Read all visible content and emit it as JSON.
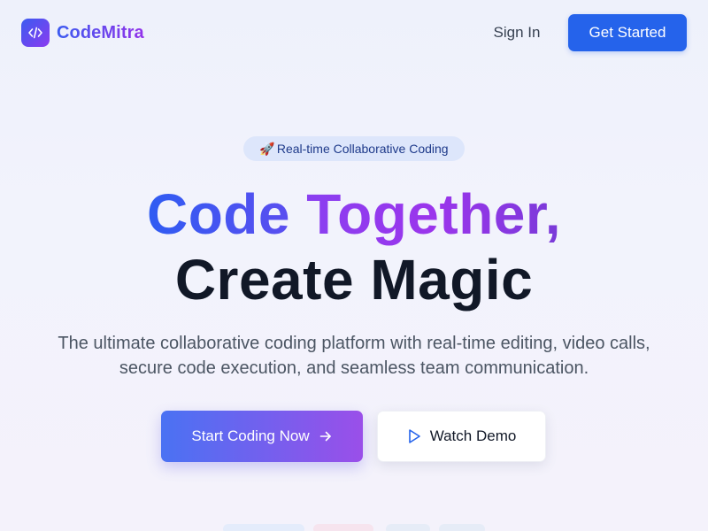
{
  "brand": {
    "name": "CodeMitra",
    "icon": "code-brackets-icon",
    "accent": "#2563eb",
    "gradient_start": "#3b5bf0",
    "gradient_end": "#9333ea"
  },
  "nav": {
    "sign_in_label": "Sign In",
    "get_started_label": "Get Started"
  },
  "hero": {
    "badge_icon": "🚀",
    "badge_text": "Real-time Collaborative Coding",
    "headline_part1": "Code",
    "headline_part2": "Together,",
    "headline_line2": "Create Magic",
    "subtitle_line1": "The ultimate collaborative coding platform with real-time editing, video calls,",
    "subtitle_line2": "secure code execution, and seamless team communication.",
    "primary_cta_label": "Start Coding Now",
    "primary_cta_icon": "arrow-right-icon",
    "secondary_cta_label": "Watch Demo",
    "secondary_cta_icon": "play-icon"
  }
}
